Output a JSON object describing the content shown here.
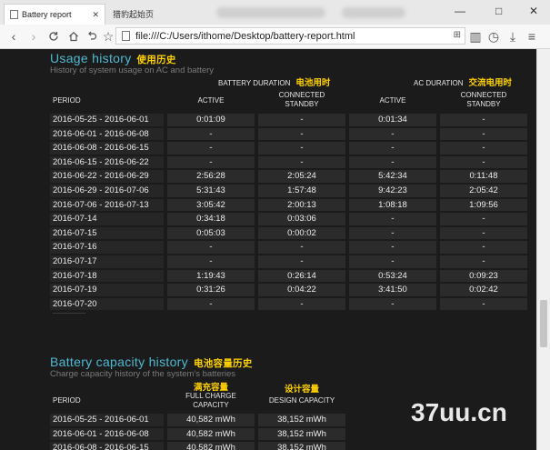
{
  "browser": {
    "tabs": [
      {
        "label": "Battery report",
        "active": true
      },
      {
        "label": "猎豹起始页",
        "active": false
      }
    ],
    "url": "file:///C:/Users/ithome/Desktop/battery-report.html",
    "window_controls": {
      "minimize": "—",
      "maximize": "□",
      "close": "✕"
    }
  },
  "usage": {
    "title": "Usage history",
    "title_cn": "使用历史",
    "subtitle": "History of system usage on AC and battery",
    "battery_duration": "BATTERY DURATION",
    "battery_duration_cn": "电池用时",
    "ac_duration": "AC DURATION",
    "ac_duration_cn": "交流电用时",
    "col_period": "PERIOD",
    "col_active": "ACTIVE",
    "col_standby_1": "CONNECTED",
    "col_standby_2": "STANDBY",
    "rows": [
      [
        "2016-05-25 - 2016-06-01",
        "0:01:09",
        "-",
        "0:01:34",
        "-"
      ],
      [
        "2016-06-01 - 2016-06-08",
        "-",
        "-",
        "-",
        "-"
      ],
      [
        "2016-06-08 - 2016-06-15",
        "-",
        "-",
        "-",
        "-"
      ],
      [
        "2016-06-15 - 2016-06-22",
        "-",
        "-",
        "-",
        "-"
      ],
      [
        "2016-06-22 - 2016-06-29",
        "2:56:28",
        "2:05:24",
        "5:42:34",
        "0:11:48"
      ],
      [
        "2016-06-29 - 2016-07-06",
        "5:31:43",
        "1:57:48",
        "9:42:23",
        "2:05:42"
      ],
      [
        "2016-07-06 - 2016-07-13",
        "3:05:42",
        "2:00:13",
        "1:08:18",
        "1:09:56"
      ],
      [
        "2016-07-14",
        "0:34:18",
        "0:03:06",
        "-",
        "-"
      ],
      [
        "2016-07-15",
        "0:05:03",
        "0:00:02",
        "-",
        "-"
      ],
      [
        "2016-07-16",
        "-",
        "-",
        "-",
        "-"
      ],
      [
        "2016-07-17",
        "-",
        "-",
        "-",
        "-"
      ],
      [
        "2016-07-18",
        "1:19:43",
        "0:26:14",
        "0:53:24",
        "0:09:23"
      ],
      [
        "2016-07-19",
        "0:31:26",
        "0:04:22",
        "3:41:50",
        "0:02:42"
      ],
      [
        "2016-07-20",
        "-",
        "-",
        "-",
        "-"
      ]
    ]
  },
  "capacity": {
    "title": "Battery capacity history",
    "title_cn": "电池容量历史",
    "subtitle": "Charge capacity history of the system's batteries",
    "col_period": "PERIOD",
    "col_full_1": "FULL CHARGE",
    "col_full_2": "CAPACITY",
    "col_full_cn": "满充容量",
    "col_design": "DESIGN CAPACITY",
    "col_design_cn": "设计容量",
    "rows": [
      [
        "2016-05-25 - 2016-06-01",
        "40,582 mWh",
        "38,152 mWh"
      ],
      [
        "2016-06-01 - 2016-06-08",
        "40,582 mWh",
        "38,152 mWh"
      ],
      [
        "2016-06-08 - 2016-06-15",
        "40,582 mWh",
        "38,152 mWh"
      ]
    ]
  },
  "watermark": "37uu.cn"
}
